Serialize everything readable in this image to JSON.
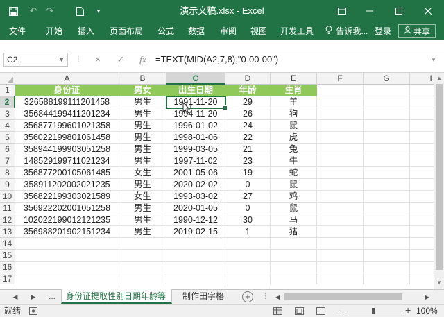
{
  "titlebar": {
    "title": "演示文稿.xlsx - Excel",
    "icons": [
      "save-icon",
      "undo-icon",
      "redo-icon",
      "new-document-icon",
      "customize-quick-access-icon",
      "ribbon-display-options-icon",
      "minimize-icon",
      "maximize-icon",
      "close-icon"
    ]
  },
  "ribbon": {
    "tabs": [
      "文件",
      "开始",
      "插入",
      "页面布局",
      "公式",
      "数据",
      "审阅",
      "视图",
      "开发工具"
    ],
    "tell_me": "告诉我...",
    "signin": "登录",
    "share": "共享"
  },
  "formula_bar": {
    "name_box": "C2",
    "cancel": "×",
    "enter": "✓",
    "fx": "fx",
    "formula": "=TEXT(MID(A2,7,8),\"0-00-00\")"
  },
  "columns": [
    "A",
    "B",
    "C",
    "D",
    "E",
    "F",
    "G",
    "H"
  ],
  "row_numbers": [
    "1",
    "2",
    "3",
    "4",
    "5",
    "6",
    "7",
    "8",
    "9",
    "10",
    "11",
    "12",
    "13",
    "14",
    "15",
    "16",
    "17"
  ],
  "header_row": [
    "身份证",
    "男女",
    "出生日期",
    "年龄",
    "生肖"
  ],
  "rows": [
    [
      "326588199111201458",
      "男生",
      "1991-11-20",
      "29",
      "羊"
    ],
    [
      "356844199411201234",
      "男生",
      "1994-11-20",
      "26",
      "狗"
    ],
    [
      "356877199601021358",
      "男生",
      "1996-01-02",
      "24",
      "鼠"
    ],
    [
      "356022199801061458",
      "男生",
      "1998-01-06",
      "22",
      "虎"
    ],
    [
      "358944199903051258",
      "男生",
      "1999-03-05",
      "21",
      "兔"
    ],
    [
      "148529199711021234",
      "男生",
      "1997-11-02",
      "23",
      "牛"
    ],
    [
      "356877200105061485",
      "女生",
      "2001-05-06",
      "19",
      "蛇"
    ],
    [
      "358911202002021235",
      "男生",
      "2020-02-02",
      "0",
      "鼠"
    ],
    [
      "356822199303021589",
      "女生",
      "1993-03-02",
      "27",
      "鸡"
    ],
    [
      "356922202001051258",
      "男生",
      "2020-01-05",
      "0",
      "鼠"
    ],
    [
      "102022199012121235",
      "男生",
      "1990-12-12",
      "30",
      "马"
    ],
    [
      "356988201902151234",
      "男生",
      "2019-02-15",
      "1",
      "猪"
    ]
  ],
  "sheet_tabs": {
    "nav_more": "...",
    "active": "身份证提取性别日期年龄等",
    "other": "制作田字格",
    "add": "+"
  },
  "status": {
    "label": "就绪",
    "zoom_minus": "-",
    "zoom_plus": "+",
    "zoom": "100%"
  }
}
